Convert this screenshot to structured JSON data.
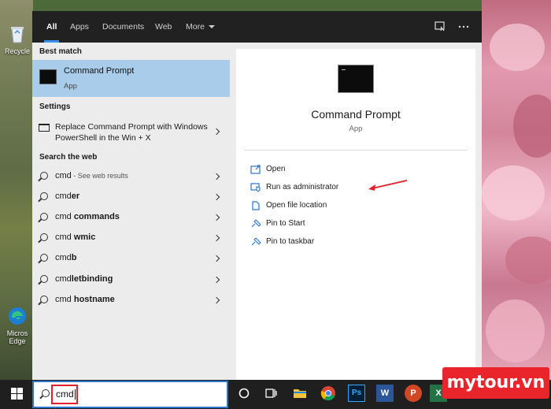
{
  "desktop": {
    "icons": [
      {
        "label": "Recycle",
        "icon": "recycle-bin-icon"
      },
      {
        "label": "Micros\nEdge",
        "icon": "edge-icon"
      }
    ]
  },
  "tabs": [
    {
      "label": "All",
      "active": true
    },
    {
      "label": "Apps",
      "active": false
    },
    {
      "label": "Documents",
      "active": false
    },
    {
      "label": "Web",
      "active": false
    },
    {
      "label": "More",
      "active": false
    }
  ],
  "toolbar_icons": [
    "feedback-icon",
    "more-options-icon"
  ],
  "best_match": {
    "section_title": "Best match",
    "name": "Command Prompt",
    "kind": "App",
    "icon": "command-prompt-icon"
  },
  "settings": {
    "section_title": "Settings",
    "item_label": "Replace Command Prompt with Windows PowerShell in the Win + X"
  },
  "web": {
    "section_title": "Search the web",
    "items": [
      {
        "prefix": "cmd",
        "bold": "",
        "sub": " - See web results"
      },
      {
        "prefix": "cmd",
        "bold": "er",
        "sub": ""
      },
      {
        "prefix": "cmd ",
        "bold": "commands",
        "sub": ""
      },
      {
        "prefix": "cmd ",
        "bold": "wmic",
        "sub": ""
      },
      {
        "prefix": "cmd",
        "bold": "b",
        "sub": ""
      },
      {
        "prefix": "cmd",
        "bold": "letbinding",
        "sub": ""
      },
      {
        "prefix": "cmd ",
        "bold": "hostname",
        "sub": ""
      }
    ]
  },
  "details": {
    "title": "Command Prompt",
    "kind": "App",
    "actions": [
      {
        "label": "Open",
        "icon": "open-icon"
      },
      {
        "label": "Run as administrator",
        "icon": "shield-icon"
      },
      {
        "label": "Open file location",
        "icon": "file-location-icon"
      },
      {
        "label": "Pin to Start",
        "icon": "pin-icon"
      },
      {
        "label": "Pin to taskbar",
        "icon": "pin-icon"
      }
    ]
  },
  "taskbar": {
    "search_value": "cmd",
    "apps": [
      "cortana-icon",
      "task-view-icon",
      "file-explorer-icon",
      "chrome-icon",
      "photoshop-icon",
      "word-icon",
      "powerpoint-icon",
      "excel-icon"
    ],
    "app_letters": {
      "photoshop": "Ps",
      "word": "W",
      "powerpoint": "P",
      "excel": "X"
    }
  },
  "colors": {
    "accent": "#3a8ee6",
    "selection": "#a9ccea",
    "annotation": "#e0202a",
    "watermark": "#e9242a"
  },
  "watermark": "mytour.vn"
}
